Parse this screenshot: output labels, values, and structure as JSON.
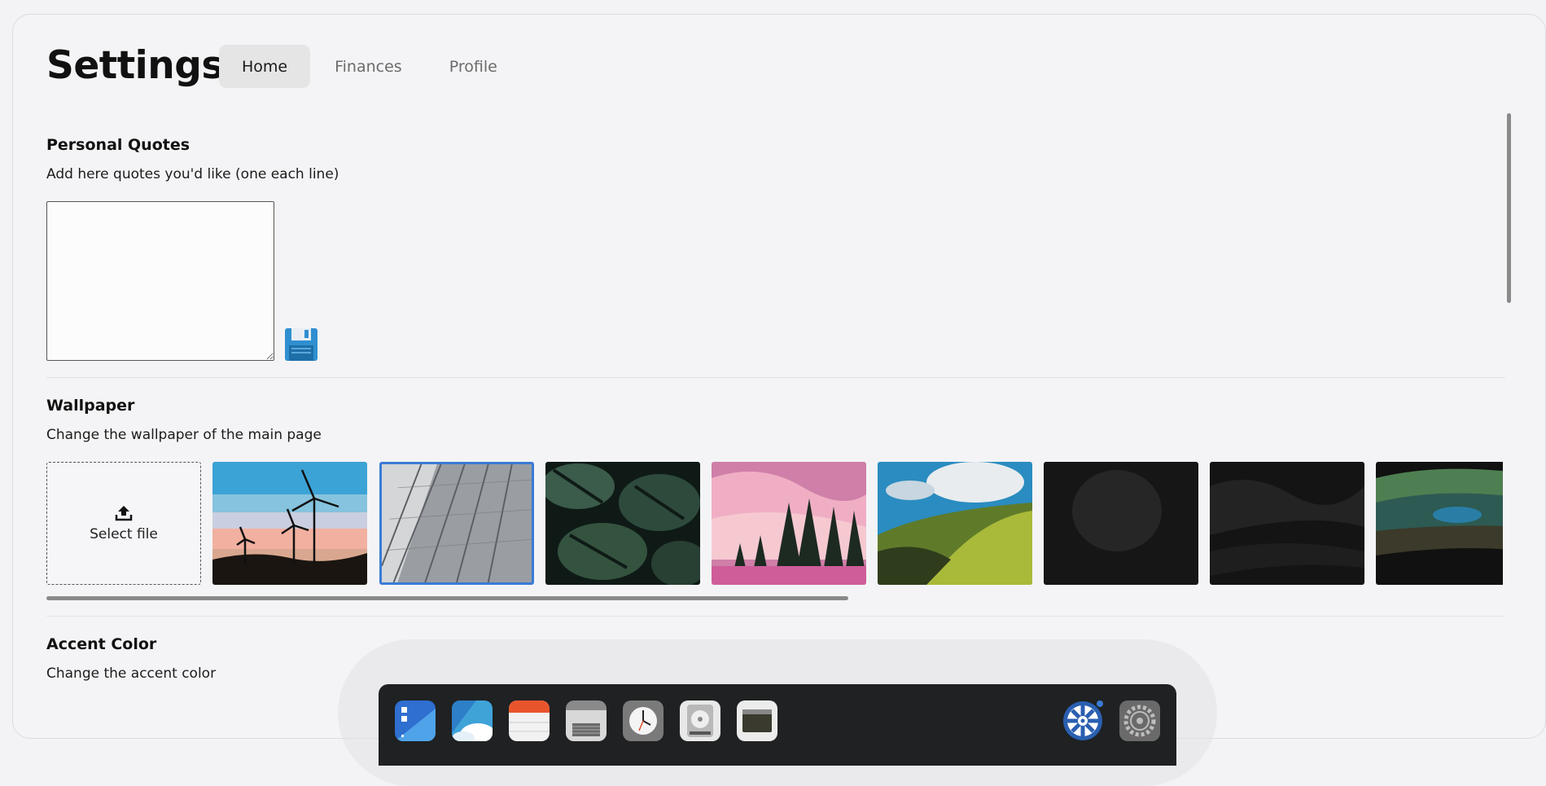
{
  "page": {
    "title": "Settings",
    "tabs": [
      {
        "label": "Home",
        "active": true
      },
      {
        "label": "Finances",
        "active": false
      },
      {
        "label": "Profile",
        "active": false
      }
    ]
  },
  "quotes": {
    "title": "Personal Quotes",
    "description": "Add here quotes you'd like (one each line)",
    "value": "",
    "save_icon": "floppy-disk-icon"
  },
  "wallpaper": {
    "title": "Wallpaper",
    "description": "Change the wallpaper of the main page",
    "upload_label": "Select file",
    "upload_icon": "upload-icon",
    "thumbnails": [
      {
        "name": "wind-turbines-sunset",
        "selected": false
      },
      {
        "name": "glass-building",
        "selected": true
      },
      {
        "name": "monstera-leaves",
        "selected": false
      },
      {
        "name": "pink-sky-forest",
        "selected": false
      },
      {
        "name": "green-hills",
        "selected": false
      },
      {
        "name": "dark-texture-1",
        "selected": false
      },
      {
        "name": "dark-texture-2",
        "selected": false
      },
      {
        "name": "dark-landscape",
        "selected": false
      }
    ]
  },
  "accent": {
    "title": "Accent Color",
    "description": "Change the accent color"
  },
  "dock": {
    "apps": [
      "dashboard-app-icon",
      "weather-app-icon",
      "notes-app-icon",
      "files-app-icon",
      "clock-app-icon",
      "disk-utility-icon",
      "terminal-app-icon"
    ],
    "system": [
      "roulette-app-icon",
      "settings-gear-icon"
    ],
    "colors": {
      "accent": "#3a7bd5",
      "dock_bg": "#1f2122"
    }
  }
}
